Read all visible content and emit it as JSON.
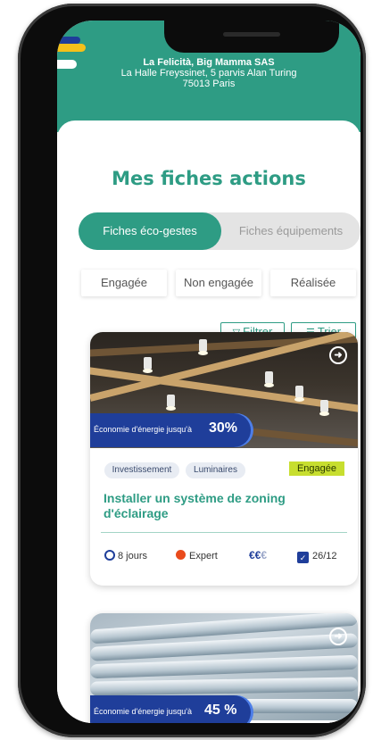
{
  "restaurant": {
    "name": "La Felicità, Big Mamma SAS",
    "address_line1": "La Halle Freyssinet, 5 parvis Alan Turing",
    "address_line2": "75013 Paris"
  },
  "page_title": "Mes fiches actions",
  "tabs": [
    {
      "label": "Fiches éco-gestes",
      "active": true
    },
    {
      "label": "Fiches équipements",
      "active": false
    }
  ],
  "status_filters": [
    "Engagée",
    "Non engagée",
    "Réalisée"
  ],
  "toolbar": {
    "filter_label": "Filtrer",
    "sort_label": "Trier"
  },
  "cards": [
    {
      "saving_label": "Économie d'énergie jusqu'à",
      "saving_value": "30%",
      "tags": [
        "Investissement",
        "Luminaires"
      ],
      "status_badge": "Engagée",
      "title": "Installer un système de zoning d'éclairage",
      "duration": "8 jours",
      "level": "Expert",
      "cost_active": "€€",
      "cost_inactive": "€",
      "date": "26/12"
    },
    {
      "saving_label": "Économie d'énergie jusqu'à",
      "saving_value": "45 %"
    }
  ],
  "colors": {
    "primary_green": "#2e9c84",
    "navy": "#1f3e9a",
    "engaged_badge": "#c7de2f",
    "expert_dot": "#e94b1c"
  }
}
